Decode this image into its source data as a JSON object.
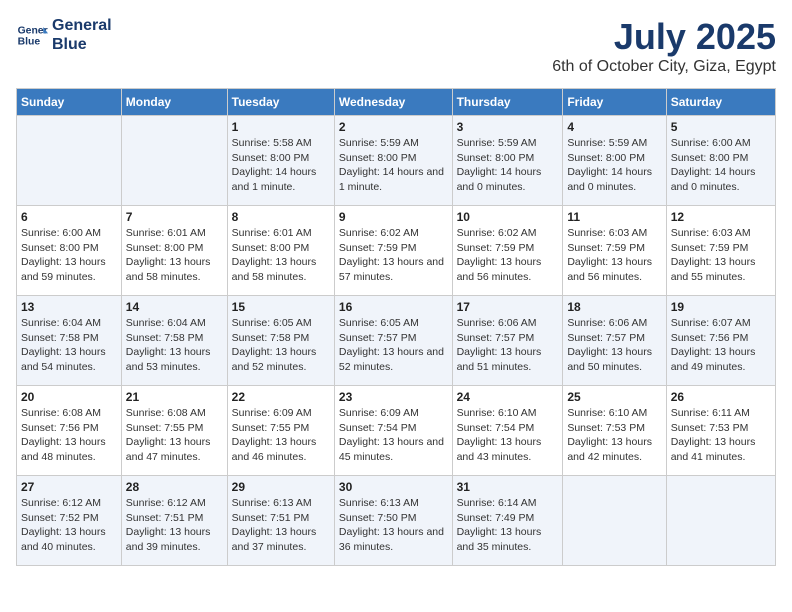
{
  "logo": {
    "line1": "General",
    "line2": "Blue"
  },
  "title": "July 2025",
  "subtitle": "6th of October City, Giza, Egypt",
  "days_of_week": [
    "Sunday",
    "Monday",
    "Tuesday",
    "Wednesday",
    "Thursday",
    "Friday",
    "Saturday"
  ],
  "weeks": [
    [
      {
        "day": "",
        "info": ""
      },
      {
        "day": "",
        "info": ""
      },
      {
        "day": "1",
        "info": "Sunrise: 5:58 AM\nSunset: 8:00 PM\nDaylight: 14 hours and 1 minute."
      },
      {
        "day": "2",
        "info": "Sunrise: 5:59 AM\nSunset: 8:00 PM\nDaylight: 14 hours and 1 minute."
      },
      {
        "day": "3",
        "info": "Sunrise: 5:59 AM\nSunset: 8:00 PM\nDaylight: 14 hours and 0 minutes."
      },
      {
        "day": "4",
        "info": "Sunrise: 5:59 AM\nSunset: 8:00 PM\nDaylight: 14 hours and 0 minutes."
      },
      {
        "day": "5",
        "info": "Sunrise: 6:00 AM\nSunset: 8:00 PM\nDaylight: 14 hours and 0 minutes."
      }
    ],
    [
      {
        "day": "6",
        "info": "Sunrise: 6:00 AM\nSunset: 8:00 PM\nDaylight: 13 hours and 59 minutes."
      },
      {
        "day": "7",
        "info": "Sunrise: 6:01 AM\nSunset: 8:00 PM\nDaylight: 13 hours and 58 minutes."
      },
      {
        "day": "8",
        "info": "Sunrise: 6:01 AM\nSunset: 8:00 PM\nDaylight: 13 hours and 58 minutes."
      },
      {
        "day": "9",
        "info": "Sunrise: 6:02 AM\nSunset: 7:59 PM\nDaylight: 13 hours and 57 minutes."
      },
      {
        "day": "10",
        "info": "Sunrise: 6:02 AM\nSunset: 7:59 PM\nDaylight: 13 hours and 56 minutes."
      },
      {
        "day": "11",
        "info": "Sunrise: 6:03 AM\nSunset: 7:59 PM\nDaylight: 13 hours and 56 minutes."
      },
      {
        "day": "12",
        "info": "Sunrise: 6:03 AM\nSunset: 7:59 PM\nDaylight: 13 hours and 55 minutes."
      }
    ],
    [
      {
        "day": "13",
        "info": "Sunrise: 6:04 AM\nSunset: 7:58 PM\nDaylight: 13 hours and 54 minutes."
      },
      {
        "day": "14",
        "info": "Sunrise: 6:04 AM\nSunset: 7:58 PM\nDaylight: 13 hours and 53 minutes."
      },
      {
        "day": "15",
        "info": "Sunrise: 6:05 AM\nSunset: 7:58 PM\nDaylight: 13 hours and 52 minutes."
      },
      {
        "day": "16",
        "info": "Sunrise: 6:05 AM\nSunset: 7:57 PM\nDaylight: 13 hours and 52 minutes."
      },
      {
        "day": "17",
        "info": "Sunrise: 6:06 AM\nSunset: 7:57 PM\nDaylight: 13 hours and 51 minutes."
      },
      {
        "day": "18",
        "info": "Sunrise: 6:06 AM\nSunset: 7:57 PM\nDaylight: 13 hours and 50 minutes."
      },
      {
        "day": "19",
        "info": "Sunrise: 6:07 AM\nSunset: 7:56 PM\nDaylight: 13 hours and 49 minutes."
      }
    ],
    [
      {
        "day": "20",
        "info": "Sunrise: 6:08 AM\nSunset: 7:56 PM\nDaylight: 13 hours and 48 minutes."
      },
      {
        "day": "21",
        "info": "Sunrise: 6:08 AM\nSunset: 7:55 PM\nDaylight: 13 hours and 47 minutes."
      },
      {
        "day": "22",
        "info": "Sunrise: 6:09 AM\nSunset: 7:55 PM\nDaylight: 13 hours and 46 minutes."
      },
      {
        "day": "23",
        "info": "Sunrise: 6:09 AM\nSunset: 7:54 PM\nDaylight: 13 hours and 45 minutes."
      },
      {
        "day": "24",
        "info": "Sunrise: 6:10 AM\nSunset: 7:54 PM\nDaylight: 13 hours and 43 minutes."
      },
      {
        "day": "25",
        "info": "Sunrise: 6:10 AM\nSunset: 7:53 PM\nDaylight: 13 hours and 42 minutes."
      },
      {
        "day": "26",
        "info": "Sunrise: 6:11 AM\nSunset: 7:53 PM\nDaylight: 13 hours and 41 minutes."
      }
    ],
    [
      {
        "day": "27",
        "info": "Sunrise: 6:12 AM\nSunset: 7:52 PM\nDaylight: 13 hours and 40 minutes."
      },
      {
        "day": "28",
        "info": "Sunrise: 6:12 AM\nSunset: 7:51 PM\nDaylight: 13 hours and 39 minutes."
      },
      {
        "day": "29",
        "info": "Sunrise: 6:13 AM\nSunset: 7:51 PM\nDaylight: 13 hours and 37 minutes."
      },
      {
        "day": "30",
        "info": "Sunrise: 6:13 AM\nSunset: 7:50 PM\nDaylight: 13 hours and 36 minutes."
      },
      {
        "day": "31",
        "info": "Sunrise: 6:14 AM\nSunset: 7:49 PM\nDaylight: 13 hours and 35 minutes."
      },
      {
        "day": "",
        "info": ""
      },
      {
        "day": "",
        "info": ""
      }
    ]
  ]
}
